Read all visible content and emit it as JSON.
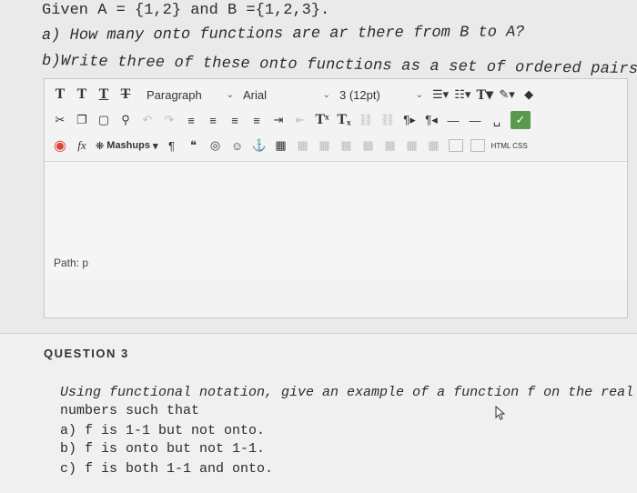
{
  "question_text": {
    "line1": "Given A = {1,2} and B ={1,2,3}.",
    "line2": "a) How many onto functions are ar there from B to A?",
    "line3": "b)Write three of these onto functions as a set of ordered pairs."
  },
  "toolbar": {
    "paragraph": "Paragraph",
    "font": "Arial",
    "size": "3 (12pt)",
    "mashups": "Mashups",
    "html_css": "HTML CSS"
  },
  "editor": {
    "path": "Path: p"
  },
  "question3": {
    "label": "QUESTION 3",
    "line1": "Using functional notation, give an example of a function f on the real",
    "line2": "numbers such that",
    "a": "a) f is 1-1 but not onto.",
    "b": "b) f is onto but not 1-1.",
    "c": "c) f is both 1-1 and onto."
  },
  "colors": {
    "accent_red": "#d9443a",
    "check_green": "#4a9a3a"
  },
  "icons": [
    "bold-t-icon",
    "italic-t-icon",
    "underline-t-icon",
    "strike-t-icon",
    "cut-icon",
    "copy-icon",
    "paste-icon",
    "find-icon",
    "align-icons",
    "superscript-icon",
    "subscript-icon",
    "link-icon",
    "paragraph-mark-icon",
    "quote-icon",
    "emoji-icon",
    "anchor-icon",
    "table-icon",
    "spellcheck-icon"
  ]
}
